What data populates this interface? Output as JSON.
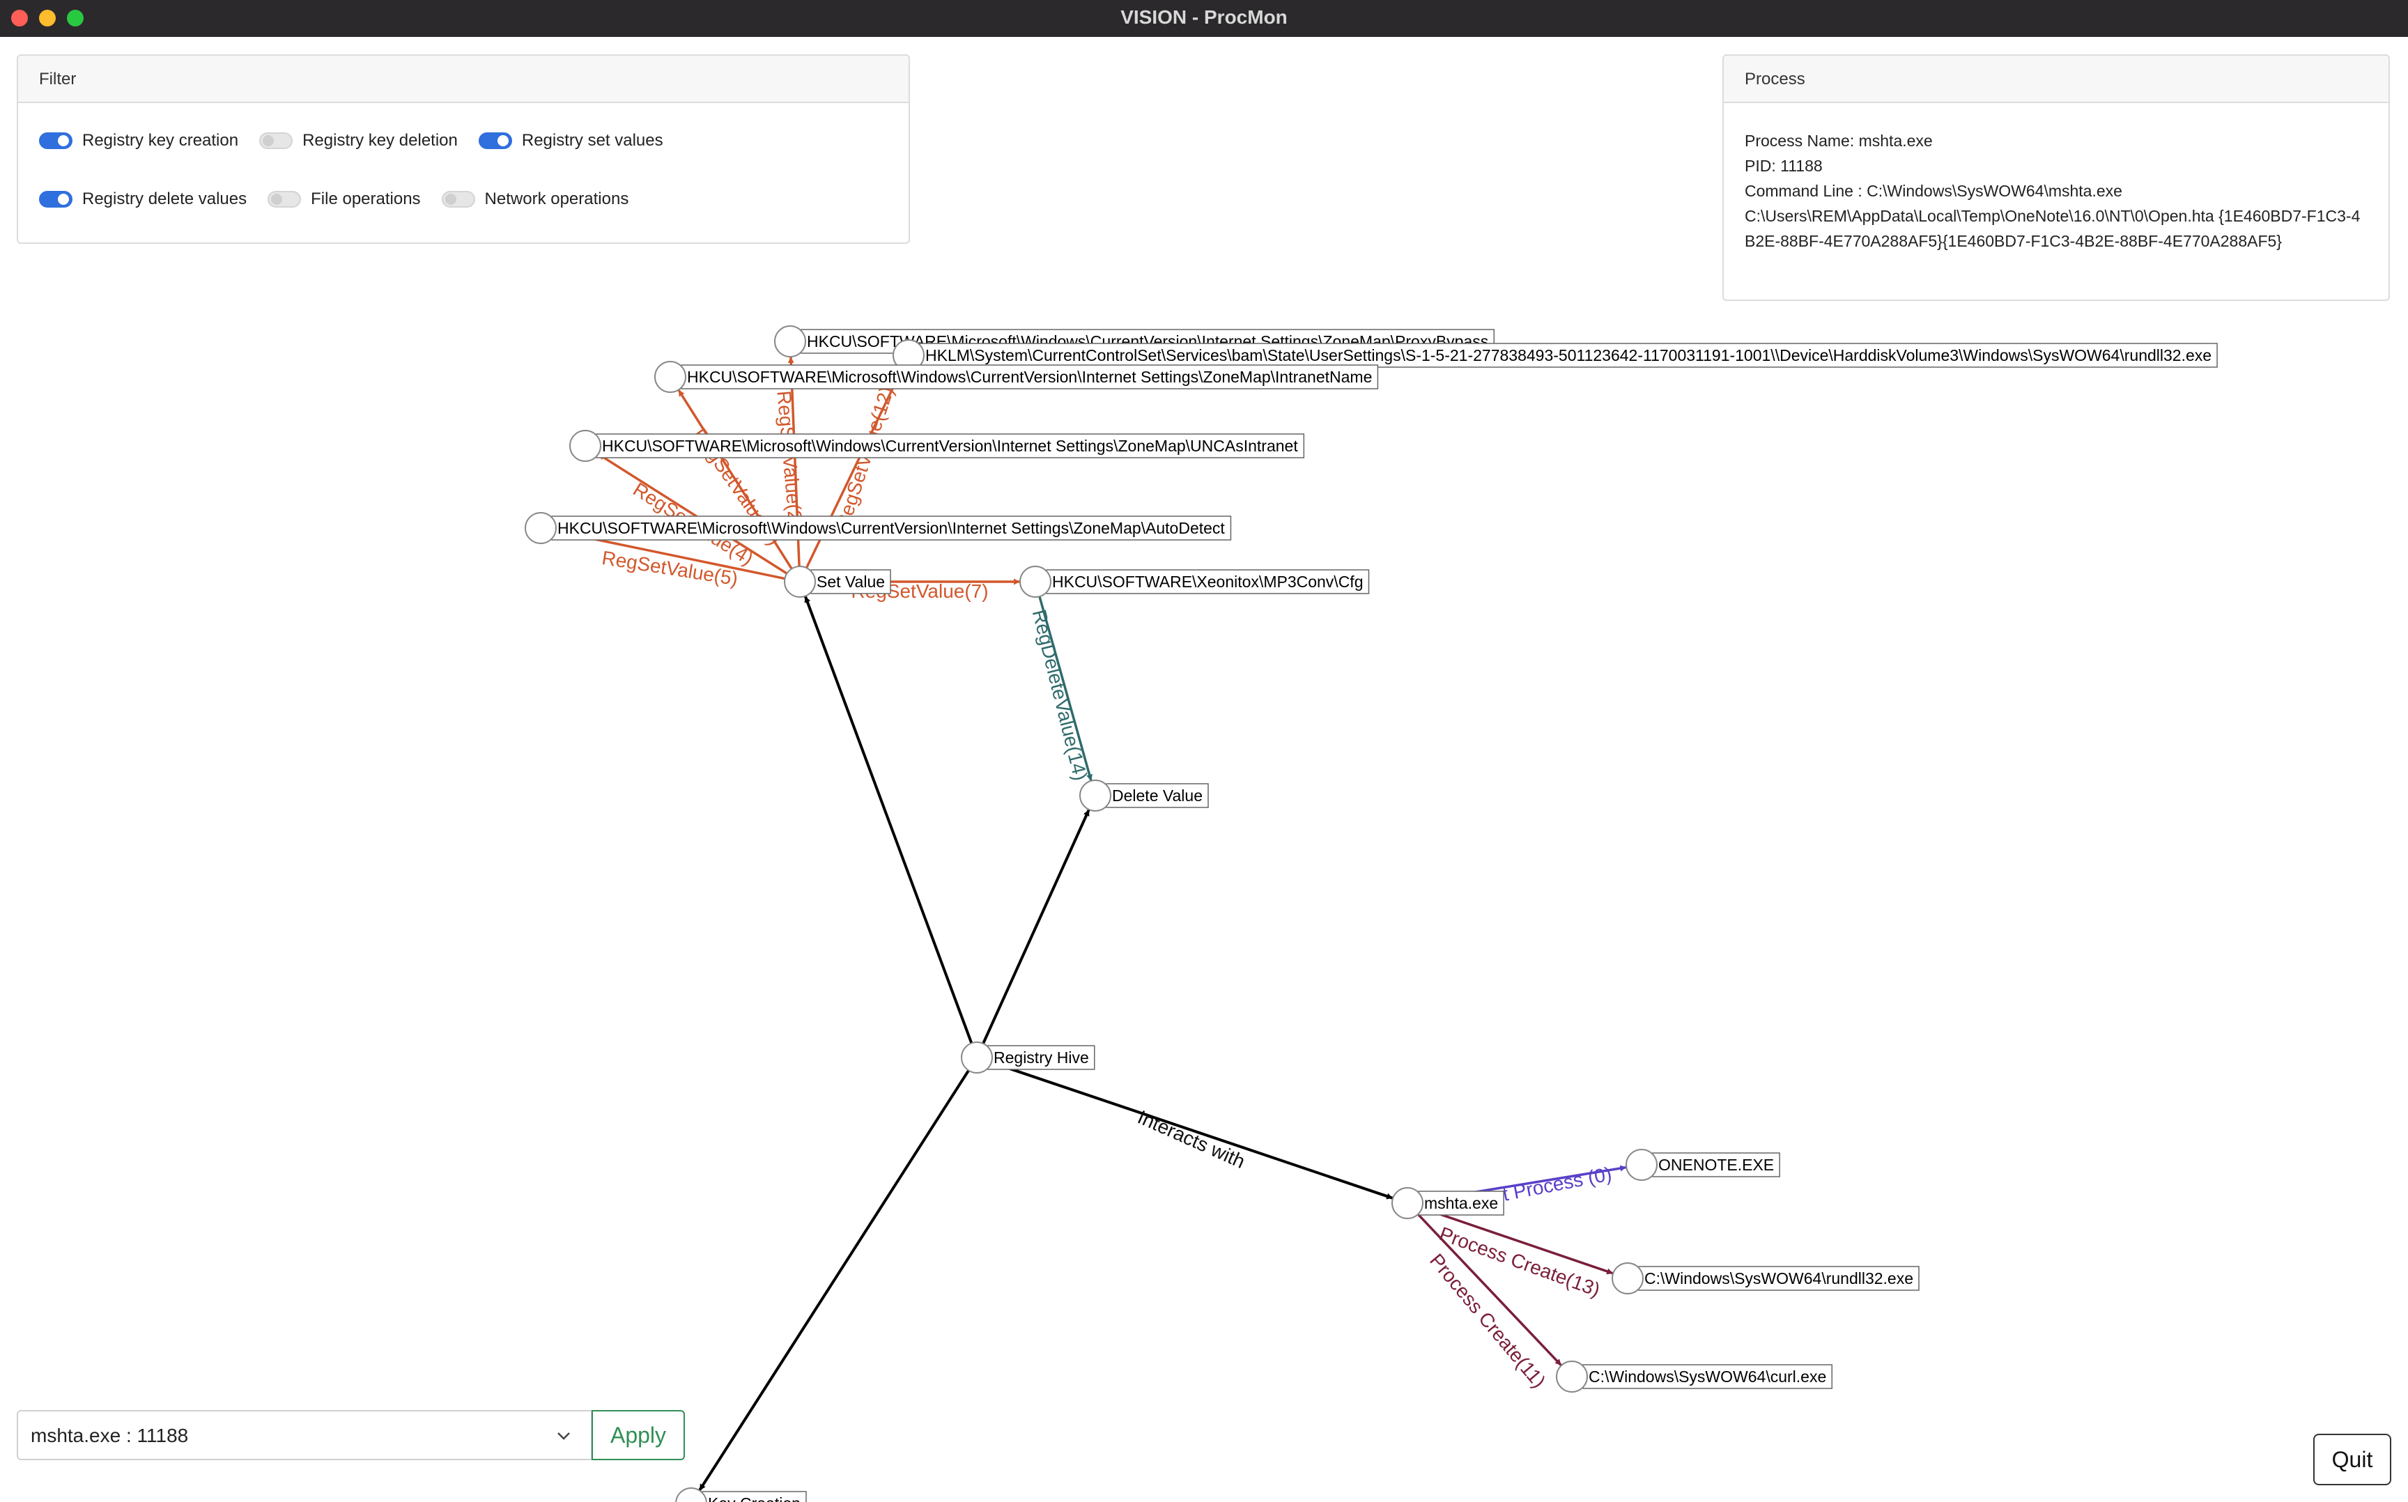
{
  "window": {
    "title": "VISION - ProcMon"
  },
  "filter": {
    "title": "Filter",
    "options": [
      {
        "label": "Registry key creation",
        "checked": true
      },
      {
        "label": "Registry key deletion",
        "checked": false
      },
      {
        "label": "Registry set values",
        "checked": true
      },
      {
        "label": "Registry delete values",
        "checked": true
      },
      {
        "label": "File operations",
        "checked": false
      },
      {
        "label": "Network operations",
        "checked": false
      }
    ]
  },
  "process": {
    "title": "Process",
    "name_line": "Process Name: mshta.exe",
    "pid_line": "PID: 11188",
    "cmd_line": "Command Line : C:\\Windows\\SysWOW64\\mshta.exe",
    "cmd_cont": "C:\\Users\\REM\\AppData\\Local\\Temp\\OneNote\\16.0\\NT\\0\\Open.hta {1E460BD7-F1C3-4B2E-88BF-4E770A288AF5}{1E460BD7-F1C3-4B2E-88BF-4E770A288AF5}"
  },
  "graph": {
    "nodes": [
      {
        "id": "proxybypass",
        "label": "HKCU\\SOFTWARE\\Microsoft\\Windows\\CurrentVersion\\Internet Settings\\ZoneMap\\ProxyBypass"
      },
      {
        "id": "bam",
        "label": "HKLM\\System\\CurrentControlSet\\Services\\bam\\State\\UserSettings\\S-1-5-21-277838493-501123642-1170031191-1001\\\\Device\\HarddiskVolume3\\Windows\\SysWOW64\\rundll32.exe"
      },
      {
        "id": "intranetname",
        "label": "HKCU\\SOFTWARE\\Microsoft\\Windows\\CurrentVersion\\Internet Settings\\ZoneMap\\IntranetName"
      },
      {
        "id": "uncas",
        "label": "HKCU\\SOFTWARE\\Microsoft\\Windows\\CurrentVersion\\Internet Settings\\ZoneMap\\UNCAsIntranet"
      },
      {
        "id": "autodetect",
        "label": "HKCU\\SOFTWARE\\Microsoft\\Windows\\CurrentVersion\\Internet Settings\\ZoneMap\\AutoDetect"
      },
      {
        "id": "setvalue",
        "label": "Set Value"
      },
      {
        "id": "xeonitox",
        "label": "HKCU\\SOFTWARE\\Xeonitox\\MP3Conv\\Cfg"
      },
      {
        "id": "deletevalue",
        "label": "Delete Value"
      },
      {
        "id": "hive",
        "label": "Registry Hive"
      },
      {
        "id": "mshta",
        "label": "mshta.exe"
      },
      {
        "id": "onenote",
        "label": "ONENOTE.EXE"
      },
      {
        "id": "rundll32",
        "label": "C:\\Windows\\SysWOW64\\rundll32.exe"
      },
      {
        "id": "curl",
        "label": "C:\\Windows\\SysWOW64\\curl.exe"
      },
      {
        "id": "keycreation",
        "label": "Key Creation"
      }
    ],
    "edges": [
      {
        "from": "hive",
        "to": "setvalue",
        "label": "",
        "color": "#000000"
      },
      {
        "from": "hive",
        "to": "deletevalue",
        "label": "",
        "color": "#000000"
      },
      {
        "from": "hive",
        "to": "keycreation",
        "label": "",
        "color": "#000000"
      },
      {
        "from": "hive",
        "to": "mshta",
        "label": "Interacts with",
        "color": "#000000"
      },
      {
        "from": "setvalue",
        "to": "xeonitox",
        "label": "RegSetValue(7)",
        "color": "#d2582c"
      },
      {
        "from": "setvalue",
        "to": "autodetect",
        "label": "RegSetValue(5)",
        "color": "#d2582c"
      },
      {
        "from": "setvalue",
        "to": "uncas",
        "label": "RegSetValue(4)",
        "color": "#d2582c"
      },
      {
        "from": "setvalue",
        "to": "intranetname",
        "label": "RegSetValue(3)",
        "color": "#d2582c"
      },
      {
        "from": "setvalue",
        "to": "proxybypass",
        "label": "RegSetValue(2)",
        "color": "#d2582c"
      },
      {
        "from": "setvalue",
        "to": "bam",
        "label": "RegSetValue(12)",
        "color": "#d2582c"
      },
      {
        "from": "xeonitox",
        "to": "deletevalue",
        "label": "RegDeleteValue(14)",
        "color": "#2f6b6b"
      },
      {
        "from": "mshta",
        "to": "onenote",
        "label": "Parent Process (0)",
        "color": "#5a3fc8"
      },
      {
        "from": "mshta",
        "to": "rundll32",
        "label": "Process Create(13)",
        "color": "#7a1f3a"
      },
      {
        "from": "mshta",
        "to": "curl",
        "label": "Process Create(11)",
        "color": "#7a1f3a"
      }
    ]
  },
  "selector": {
    "value": "mshta.exe : 11188"
  },
  "apply_label": "Apply",
  "quit_label": "Quit",
  "icons": {
    "dropdown": "chevron-down-icon"
  }
}
